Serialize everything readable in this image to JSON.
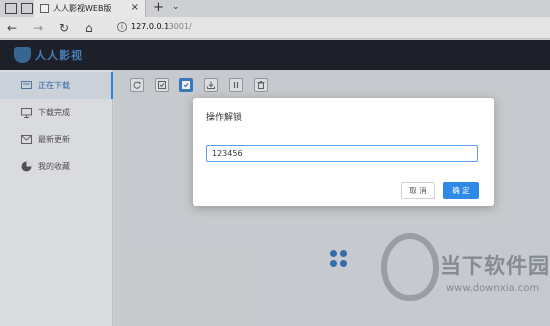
{
  "browser": {
    "tab_title": "人人影视WEB版",
    "tab_close": "×",
    "new_tab": "+",
    "tab_menu": "⌄",
    "back": "←",
    "forward": "→",
    "reload": "↻",
    "home": "⌂",
    "address_host": "127.0.0.1",
    "address_path": ":3001/"
  },
  "app": {
    "logo_text": "人人影视",
    "sidebar": {
      "items": [
        {
          "label": "正在下载",
          "icon": "download-list-icon",
          "active": true
        },
        {
          "label": "下载完成",
          "icon": "monitor-icon",
          "active": false
        },
        {
          "label": "最新更新",
          "icon": "mail-icon",
          "active": false
        },
        {
          "label": "我的收藏",
          "icon": "pie-chart-icon",
          "active": false
        }
      ]
    },
    "toolbar": [
      "refresh-icon",
      "checkbox-icon",
      "checked-box-icon",
      "import-icon",
      "pause-icon",
      "trash-icon"
    ]
  },
  "dialog": {
    "title": "操作解锁",
    "input_value": "123456",
    "cancel_label": "取 消",
    "ok_label": "确 定"
  },
  "watermark": {
    "text": "当下软件园",
    "url": "www.downxia.com"
  },
  "colors": {
    "accent": "#2f89e6",
    "header_bg": "#1f232c",
    "sidebar_bg": "#e7e9ec"
  }
}
